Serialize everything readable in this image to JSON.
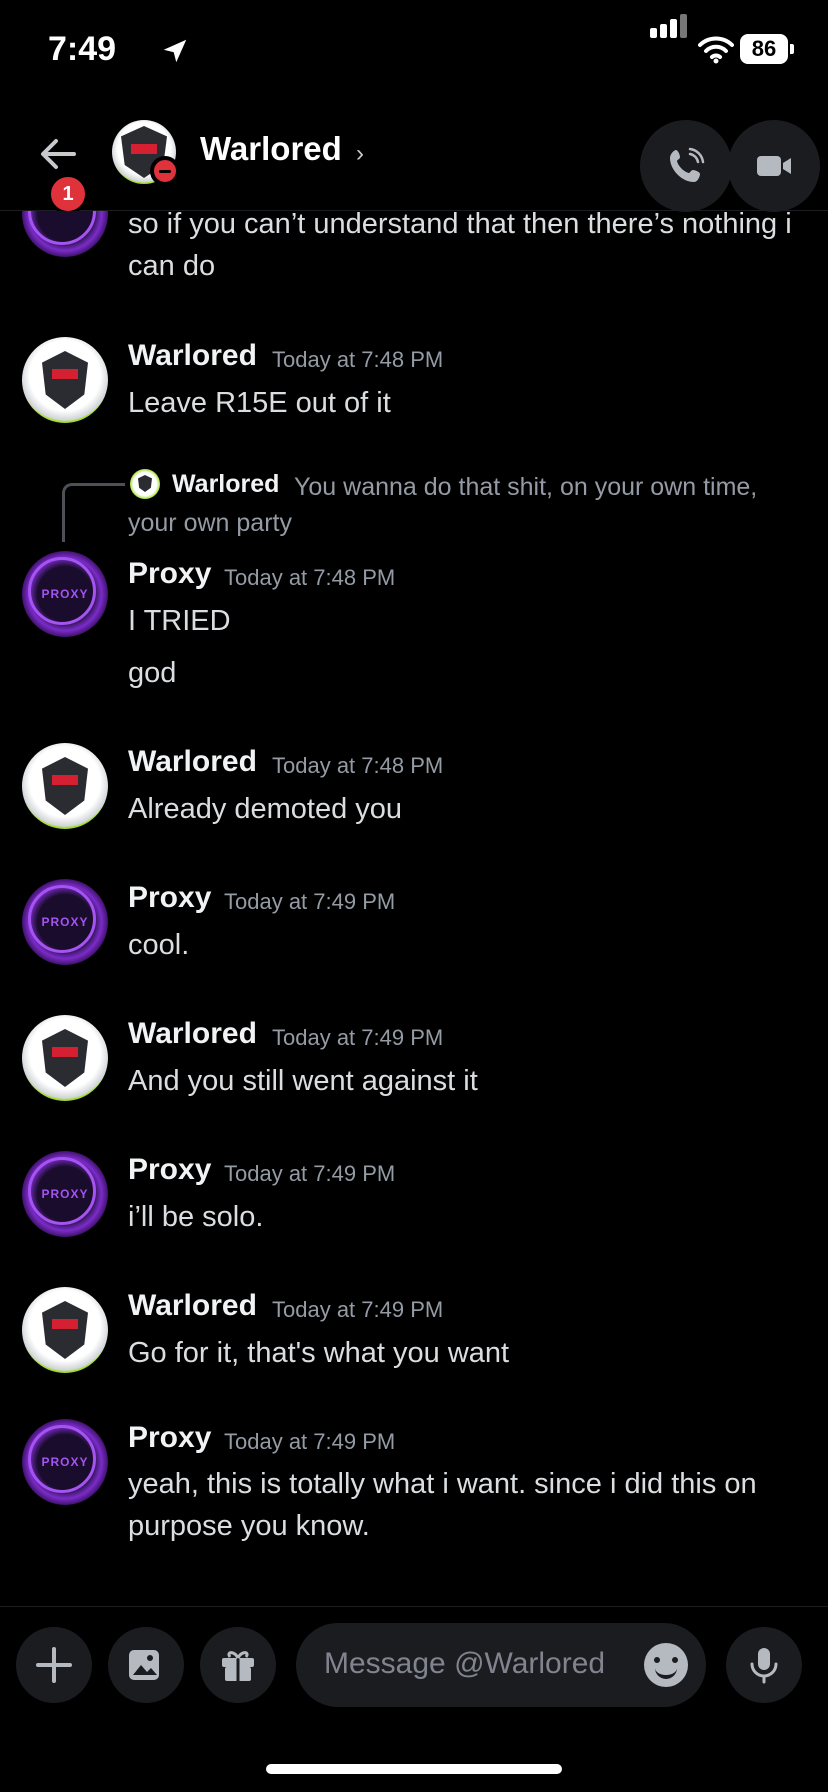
{
  "status_bar": {
    "time": "7:49",
    "battery": "86"
  },
  "header": {
    "contact_name": "Warlored",
    "notification_count": "1"
  },
  "messages": [
    {
      "author": "",
      "timestamp": "",
      "lines": [
        "so if you can’t understand that then there’s nothing i can do"
      ],
      "avatar": "proxy"
    },
    {
      "author": "Warlored",
      "timestamp": "Today at 7:48 PM",
      "lines": [
        "Leave R15E out of it"
      ],
      "avatar": "warlored"
    },
    {
      "reply": {
        "author": "Warlored",
        "text": "You wanna do that shit, on your own time, your own party"
      },
      "author": "Proxy",
      "timestamp": "Today at 7:48 PM",
      "lines": [
        "I TRIED",
        "god"
      ],
      "avatar": "proxy"
    },
    {
      "author": "Warlored",
      "timestamp": "Today at 7:48 PM",
      "lines": [
        "Already demoted you"
      ],
      "avatar": "warlored"
    },
    {
      "author": "Proxy",
      "timestamp": "Today at 7:49 PM",
      "lines": [
        "cool."
      ],
      "avatar": "proxy"
    },
    {
      "author": "Warlored",
      "timestamp": "Today at 7:49 PM",
      "lines": [
        "And you still went against it"
      ],
      "avatar": "warlored"
    },
    {
      "author": "Proxy",
      "timestamp": "Today at 7:49 PM",
      "lines": [
        "i’ll be solo."
      ],
      "avatar": "proxy"
    },
    {
      "author": "Warlored",
      "timestamp": "Today at 7:49 PM",
      "lines": [
        "Go for it, that's what you want"
      ],
      "avatar": "warlored"
    },
    {
      "author": "Proxy",
      "timestamp": "Today at 7:49 PM",
      "lines": [
        "yeah, this is totally what i want. since i did this on purpose you know."
      ],
      "avatar": "proxy"
    }
  ],
  "avatar_labels": {
    "proxy": "PROXY"
  },
  "composer": {
    "placeholder": "Message @Warlored"
  },
  "colors": {
    "background": "#000000",
    "button_bg": "#1b1c20",
    "timestamp": "#949ba4",
    "dnd": "#e0323b",
    "proxy_purple": "#a553f2",
    "warlored_green": "#a8e03a"
  }
}
